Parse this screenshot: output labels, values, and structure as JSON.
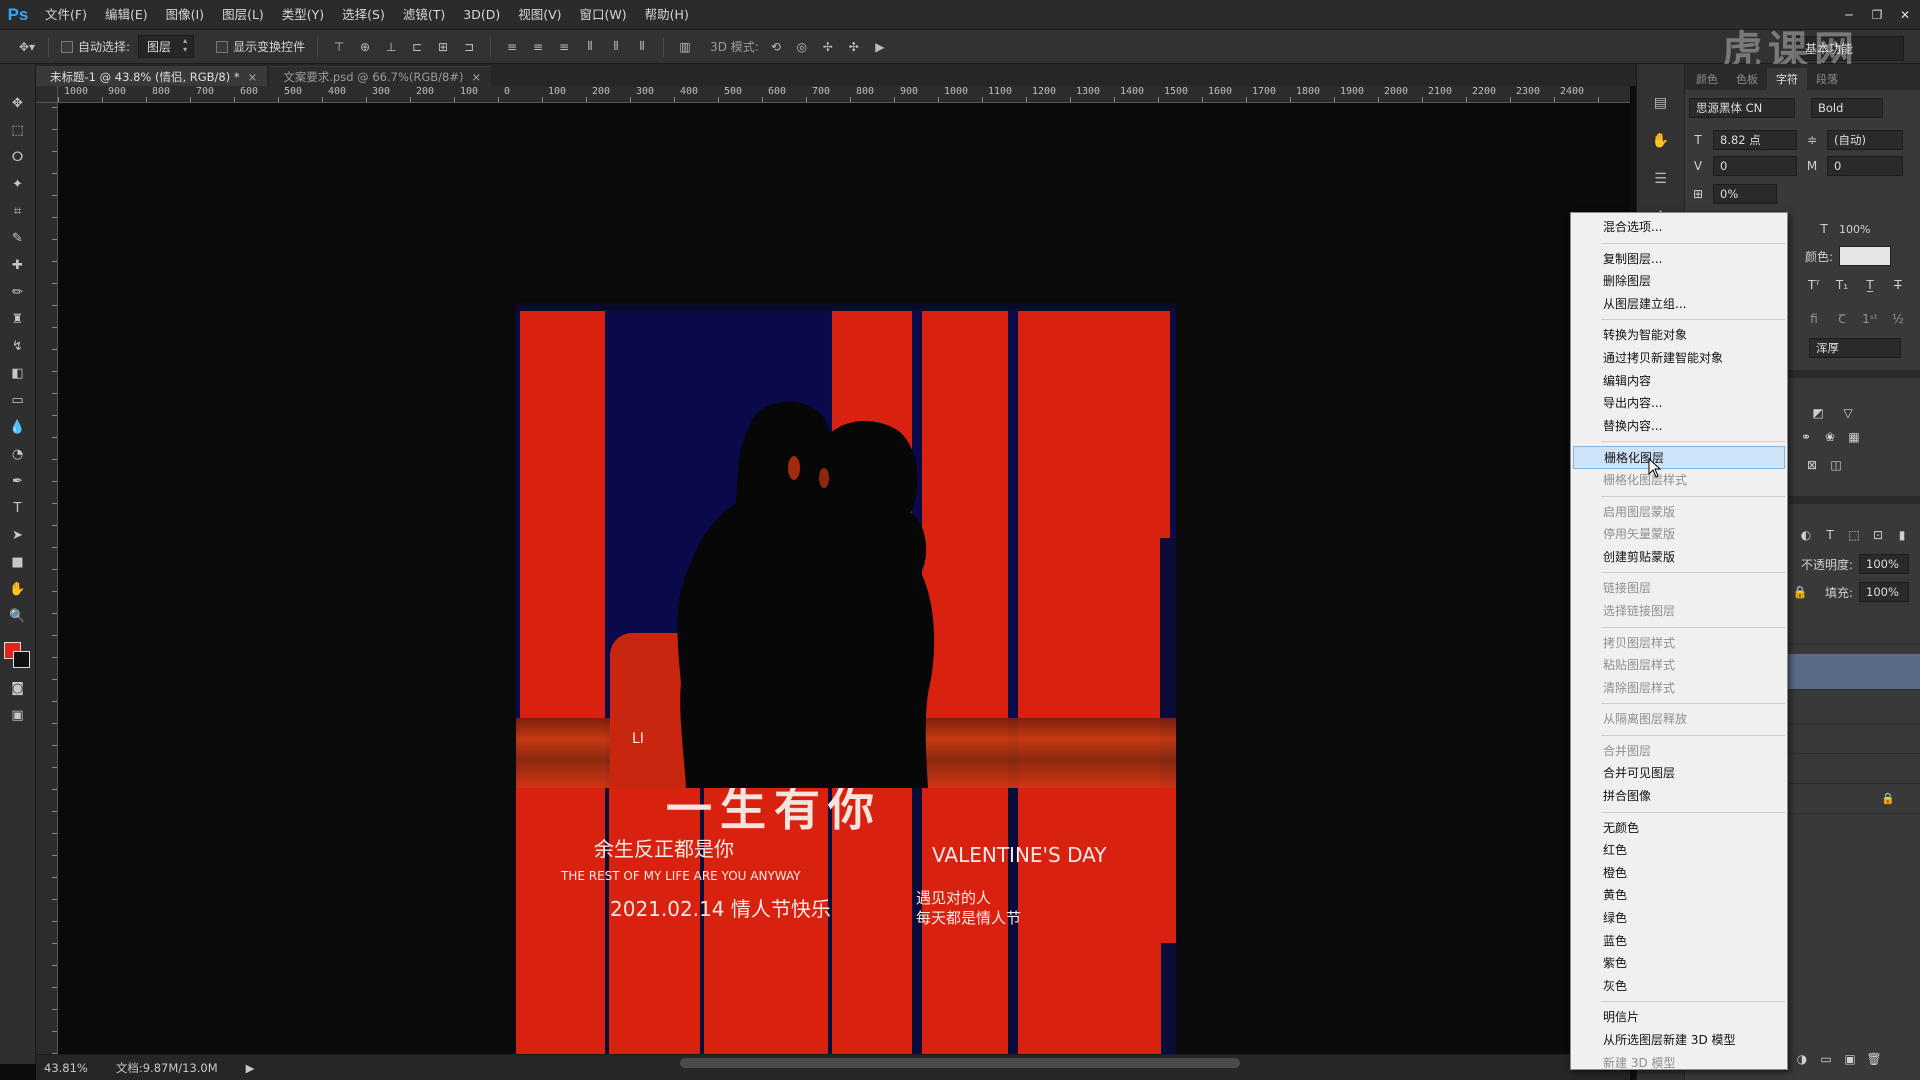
{
  "app": {
    "logo": "Ps",
    "menus": [
      "文件(F)",
      "编辑(E)",
      "图像(I)",
      "图层(L)",
      "类型(Y)",
      "选择(S)",
      "滤镜(T)",
      "3D(D)",
      "视图(V)",
      "窗口(W)",
      "帮助(H)"
    ],
    "workspace": "基本功能",
    "watermark": "虎课网"
  },
  "options": {
    "auto_select_label": "自动选择:",
    "auto_select_value": "图层",
    "show_transform_label": "显示变换控件",
    "mode_3d_label": "3D 模式:"
  },
  "tabs": [
    {
      "label": "未标题-1 @ 43.8% (情侣, RGB/8) *",
      "active": true
    },
    {
      "label": "文案要求.psd @ 66.7%(RGB/8#)",
      "active": false
    }
  ],
  "ruler_labels": [
    "1000",
    "900",
    "800",
    "700",
    "600",
    "500",
    "400",
    "300",
    "200",
    "100",
    "0",
    "100",
    "200",
    "300",
    "400",
    "500",
    "600",
    "700",
    "800",
    "900",
    "1000",
    "1100",
    "1200",
    "1300",
    "1400",
    "1500",
    "1600",
    "1700",
    "1800",
    "1900",
    "2000",
    "2100",
    "2200",
    "2300",
    "2400"
  ],
  "poster": {
    "title": "一生有你",
    "small_label": "LI",
    "line1": "余生反正都是你",
    "line2": "THE REST OF MY LIFE ARE YOU ANYWAY",
    "line3": "2021.02.14 情人节快乐",
    "valentine": "VALENTINE'S DAY",
    "meet1": "遇见对的人",
    "meet2": "每天都是情人节"
  },
  "status": {
    "zoom": "43.81%",
    "doc": "文档:9.87M/13.0M"
  },
  "character_panel": {
    "tabs": [
      "颜色",
      "色板",
      "字符",
      "段落"
    ],
    "active_tab": "字符",
    "font_family": "思源黑体 CN",
    "font_style": "Bold",
    "size": "8.82 点",
    "leading": "(自动)",
    "kerning": "0",
    "tracking": "0",
    "scale_pct": "0%",
    "vscale": "100%",
    "color_label": "颜色:",
    "aa_method": "浑厚"
  },
  "layers_panel": {
    "opacity_label": "不透明度:",
    "opacity": "100%",
    "fill_label": "填充:",
    "fill": "100%"
  },
  "context_menu": {
    "groups": [
      [
        {
          "label": "混合选项...",
          "disabled": false
        }
      ],
      [
        {
          "label": "复制图层...",
          "disabled": false
        },
        {
          "label": "删除图层",
          "disabled": false
        },
        {
          "label": "从图层建立组...",
          "disabled": false
        }
      ],
      [
        {
          "label": "转换为智能对象",
          "disabled": false
        },
        {
          "label": "通过拷贝新建智能对象",
          "disabled": false
        },
        {
          "label": "编辑内容",
          "disabled": false
        },
        {
          "label": "导出内容...",
          "disabled": false
        },
        {
          "label": "替换内容...",
          "disabled": false
        }
      ],
      [
        {
          "label": "栅格化图层",
          "disabled": false,
          "highlight": true
        },
        {
          "label": "栅格化图层样式",
          "disabled": true
        }
      ],
      [
        {
          "label": "启用图层蒙版",
          "disabled": true
        },
        {
          "label": "停用矢量蒙版",
          "disabled": true
        },
        {
          "label": "创建剪贴蒙版",
          "disabled": false
        }
      ],
      [
        {
          "label": "链接图层",
          "disabled": true
        },
        {
          "label": "选择链接图层",
          "disabled": true
        }
      ],
      [
        {
          "label": "拷贝图层样式",
          "disabled": true
        },
        {
          "label": "粘贴图层样式",
          "disabled": true
        },
        {
          "label": "清除图层样式",
          "disabled": true
        }
      ],
      [
        {
          "label": "从隔离图层释放",
          "disabled": true
        }
      ],
      [
        {
          "label": "合并图层",
          "disabled": true
        },
        {
          "label": "合并可见图层",
          "disabled": false
        },
        {
          "label": "拼合图像",
          "disabled": false
        }
      ],
      [
        {
          "label": "无颜色",
          "disabled": false
        },
        {
          "label": "红色",
          "disabled": false
        },
        {
          "label": "橙色",
          "disabled": false
        },
        {
          "label": "黄色",
          "disabled": false
        },
        {
          "label": "绿色",
          "disabled": false
        },
        {
          "label": "蓝色",
          "disabled": false
        },
        {
          "label": "紫色",
          "disabled": false
        },
        {
          "label": "灰色",
          "disabled": false
        }
      ],
      [
        {
          "label": "明信片",
          "disabled": false
        },
        {
          "label": "从所选图层新建 3D 模型",
          "disabled": false
        },
        {
          "label": "新建 3D 模型",
          "disabled": true
        }
      ]
    ]
  },
  "colors": {
    "foreground": "#e2231a",
    "background": "#111111",
    "poster_red": "#d8210f",
    "poster_navy": "#0a0a4a"
  }
}
